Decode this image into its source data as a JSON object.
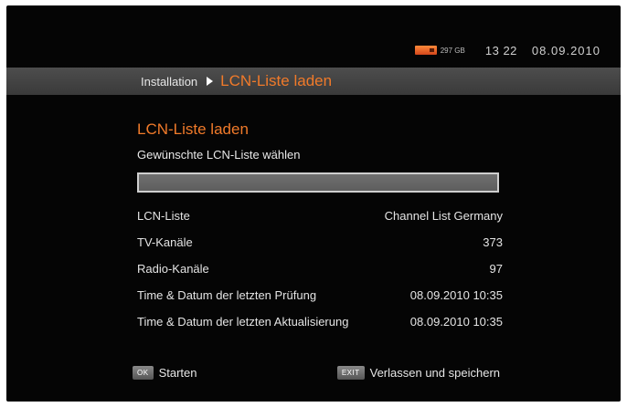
{
  "status_bar": {
    "hdd_free": "297 GB",
    "time": "13 22",
    "date": "08.09.2010"
  },
  "breadcrumb": {
    "parent": "Installation",
    "current": "LCN-Liste laden"
  },
  "main": {
    "title": "LCN-Liste laden",
    "prompt": "Gewünschte LCN-Liste wählen",
    "selection_value": "",
    "rows": [
      {
        "label": "LCN-Liste",
        "value": "Channel List Germany"
      },
      {
        "label": "TV-Kanäle",
        "value": "373"
      },
      {
        "label": "Radio-Kanäle",
        "value": "97"
      },
      {
        "label": "Time & Datum der letzten Prüfung",
        "value": "08.09.2010 10:35"
      },
      {
        "label": "Time & Datum der letzten Aktualisierung",
        "value": "08.09.2010 10:35"
      }
    ]
  },
  "footer": {
    "ok_key": "OK",
    "ok_label": "Starten",
    "exit_key": "EXIT",
    "exit_label": "Verlassen und speichern"
  },
  "icons": {
    "hdd": "hdd-icon",
    "arrow": "triangle-right-icon"
  },
  "colors": {
    "accent": "#f07a2a",
    "background": "#050505",
    "bar": "#444444"
  }
}
